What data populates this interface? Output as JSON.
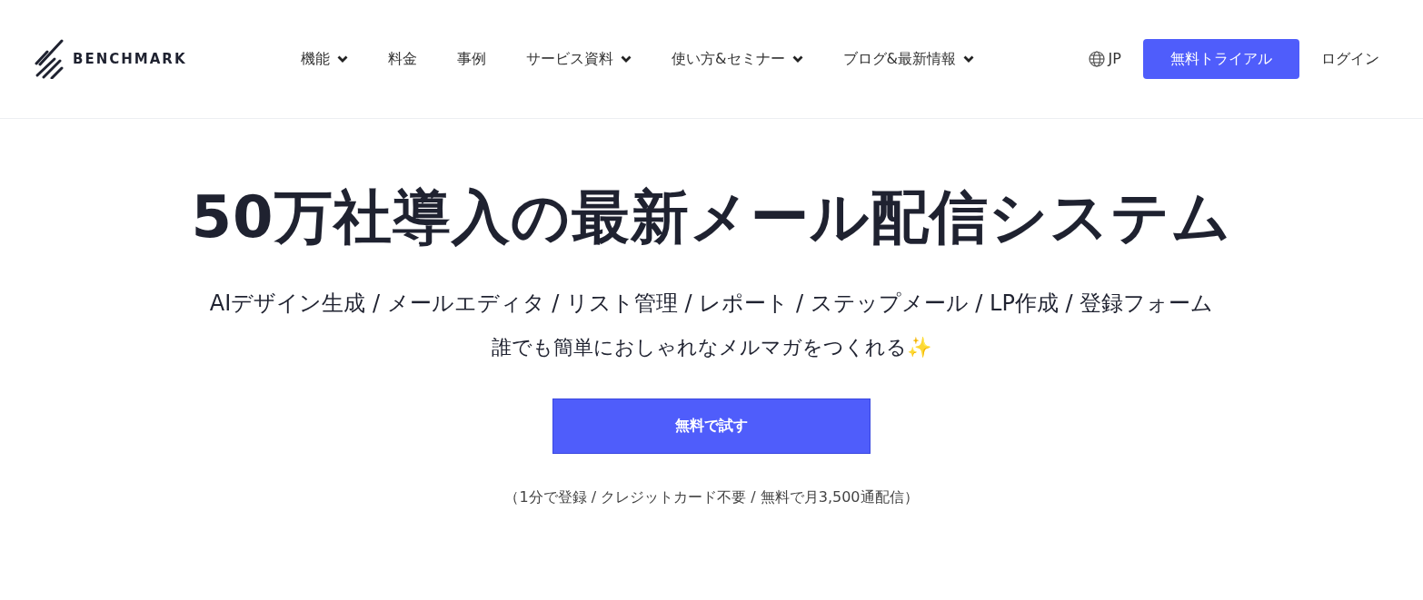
{
  "header": {
    "logo": "BENCHMARK",
    "nav": [
      {
        "label": "機能",
        "dropdown": true
      },
      {
        "label": "料金",
        "dropdown": false
      },
      {
        "label": "事例",
        "dropdown": false
      },
      {
        "label": "サービス資料",
        "dropdown": true
      },
      {
        "label": "使い方&セミナー",
        "dropdown": true
      },
      {
        "label": "ブログ&最新情報",
        "dropdown": true
      }
    ],
    "language": "JP",
    "trial_button": "無料トライアル",
    "login": "ログイン"
  },
  "hero": {
    "title": "50万社導入の最新メール配信システム",
    "features": "AIデザイン生成 / メールエディタ / リスト管理 / レポート / ステップメール / LP作成 / 登録フォーム",
    "tagline": "誰でも簡単におしゃれなメルマガをつくれる✨",
    "cta": "無料で試す",
    "note": "（1分で登録 / クレジットカード不要 / 無料で月3,500通配信）"
  }
}
